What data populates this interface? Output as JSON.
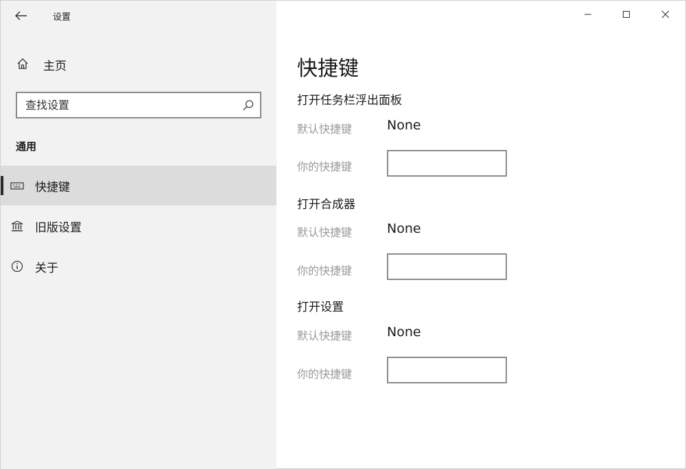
{
  "window": {
    "title": "设置",
    "controls": {
      "minimize": "—",
      "maximize": "☐",
      "close": "✕"
    }
  },
  "sidebar": {
    "home_label": "主页",
    "search_placeholder": "查找设置",
    "section_label": "通用",
    "items": [
      {
        "label": "快捷键",
        "icon": "keyboard-icon",
        "selected": true
      },
      {
        "label": "旧版设置",
        "icon": "bank-icon",
        "selected": false
      },
      {
        "label": "关于",
        "icon": "info-icon",
        "selected": false
      }
    ]
  },
  "main": {
    "title": "快捷键",
    "groups": [
      {
        "title": "打开任务栏浮出面板",
        "default_label": "默认快捷键",
        "default_value": "None",
        "custom_label": "你的快捷键",
        "custom_value": ""
      },
      {
        "title": "打开合成器",
        "default_label": "默认快捷键",
        "default_value": "None",
        "custom_label": "你的快捷键",
        "custom_value": ""
      },
      {
        "title": "打开设置",
        "default_label": "默认快捷键",
        "default_value": "None",
        "custom_label": "你的快捷键",
        "custom_value": ""
      }
    ]
  }
}
